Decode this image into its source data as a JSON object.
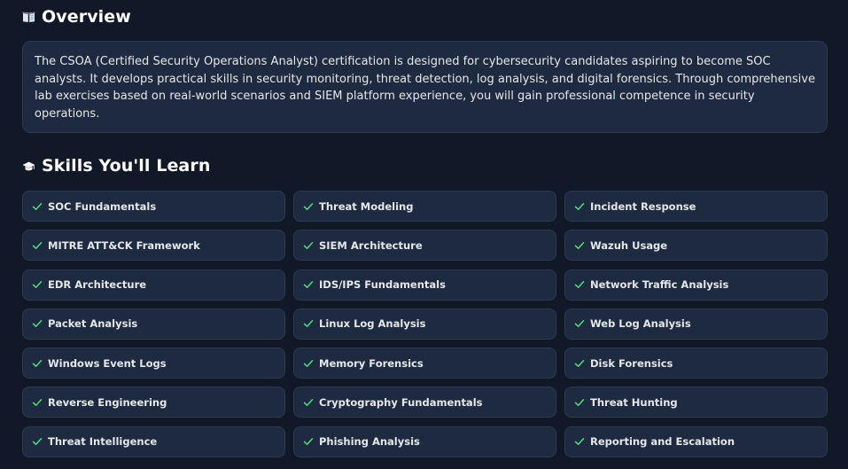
{
  "overview": {
    "heading": "Overview",
    "icon": "book-icon",
    "text": "The CSOA (Certified Security Operations Analyst) certification is designed for cybersecurity candidates aspiring to become SOC analysts. It develops practical skills in security monitoring, threat detection, log analysis, and digital forensics. Through comprehensive lab exercises based on real-world scenarios and SIEM platform experience, you will gain professional competence in security operations."
  },
  "skills": {
    "heading": "Skills You'll Learn",
    "icon": "graduation-cap-icon",
    "item_icon": "check-icon",
    "items": [
      "SOC Fundamentals",
      "Threat Modeling",
      "Incident Response",
      "MITRE ATT&CK Framework",
      "SIEM Architecture",
      "Wazuh Usage",
      "EDR Architecture",
      "IDS/IPS Fundamentals",
      "Network Traffic Analysis",
      "Packet Analysis",
      "Linux Log Analysis",
      "Web Log Analysis",
      "Windows Event Logs",
      "Memory Forensics",
      "Disk Forensics",
      "Reverse Engineering",
      "Cryptography Fundamentals",
      "Threat Hunting",
      "Threat Intelligence",
      "Phishing Analysis",
      "Reporting and Escalation"
    ]
  },
  "colors": {
    "background": "#111827",
    "card": "#1e2a3f",
    "card_border": "#2c3a52",
    "check": "#4ade80",
    "heading": "#ffffff"
  }
}
